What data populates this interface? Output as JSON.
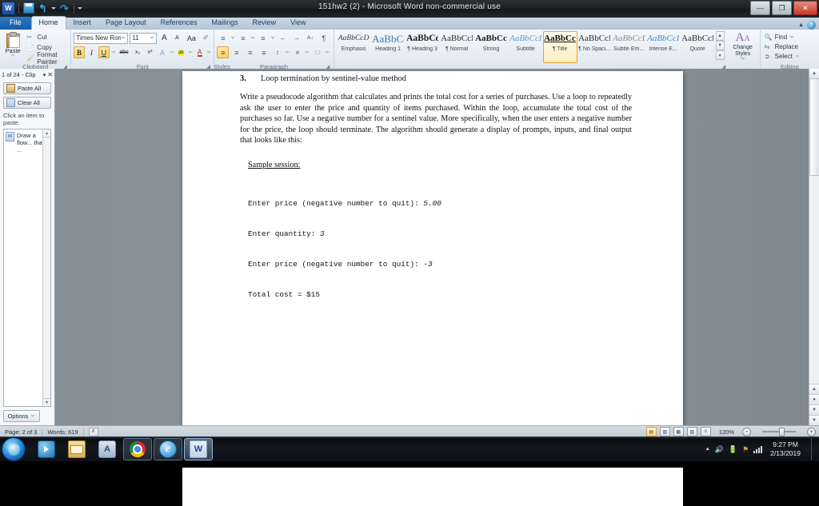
{
  "window": {
    "title": "151hw2 (2)  -  Microsoft Word non-commercial use",
    "app_icon": "W",
    "quick_access": [
      {
        "name": "save",
        "icon": "save-icon"
      },
      {
        "name": "undo",
        "icon": "undo-icon",
        "glyph": "↶"
      },
      {
        "name": "redo",
        "icon": "redo-icon",
        "glyph": "↷"
      }
    ],
    "controls": {
      "minimize": "—",
      "restore": "❐",
      "close": "✕"
    },
    "help": "?",
    "collapse_ribbon": "▲"
  },
  "ribbon": {
    "tabs": [
      {
        "label": "File",
        "type": "file"
      },
      {
        "label": "Home",
        "active": true
      },
      {
        "label": "Insert"
      },
      {
        "label": "Page Layout"
      },
      {
        "label": "References"
      },
      {
        "label": "Mailings"
      },
      {
        "label": "Review"
      },
      {
        "label": "View"
      }
    ],
    "clipboard": {
      "group_label": "Clipboard",
      "paste_label": "Paste",
      "cut_label": "Cut",
      "copy_label": "Copy",
      "format_painter_label": "Format Painter"
    },
    "font": {
      "group_label": "Font",
      "font_name": "Times New Rom",
      "font_size": "11",
      "grow_font": "A",
      "shrink_font": "A",
      "change_case": "Aa",
      "clear_formatting": "✐",
      "bold": "B",
      "italic": "I",
      "underline": "U",
      "strikethrough": "abc",
      "subscript": "x₂",
      "superscript": "x²",
      "text_effects": "A",
      "highlight": "ab",
      "font_color": "A"
    },
    "paragraph": {
      "group_label": "Paragraph",
      "bullets": "≡",
      "numbering": "≡",
      "multilevel": "≡",
      "decrease_indent": "←",
      "increase_indent": "→",
      "sort": "A↓",
      "show_marks": "¶",
      "align_left": "≡",
      "align_center": "≡",
      "align_right": "≡",
      "justify": "≡",
      "line_spacing": "↕",
      "shading": "■",
      "borders": "□"
    },
    "styles": {
      "group_label": "Styles",
      "items": [
        {
          "preview": "AaBbCcD",
          "name": "Emphasis",
          "style": "emphasis"
        },
        {
          "preview": "AaBbCс",
          "name": "Heading 1",
          "style": "heading1"
        },
        {
          "preview": "AaBbCc",
          "name": "¶ Heading 3",
          "style": "heading3"
        },
        {
          "preview": "AaBbCcI",
          "name": "¶ Normal",
          "style": "normal"
        },
        {
          "preview": "AaBbCcI",
          "name": "Strong",
          "style": "strong"
        },
        {
          "preview": "AaBbCcI",
          "name": "Subtitle",
          "style": "subtitle"
        },
        {
          "preview": "AaBbCcI",
          "name": "¶ Title",
          "style": "title",
          "selected": true
        },
        {
          "preview": "AaBbCcI",
          "name": "¶ No Spaci...",
          "style": "nospacing"
        },
        {
          "preview": "AaBbCcD",
          "name": "Subtle Em...",
          "style": "subtleem"
        },
        {
          "preview": "AaBbCcI",
          "name": "Intense E...",
          "style": "intenseem"
        },
        {
          "preview": "AaBbCcD",
          "name": "Quote",
          "style": "quote"
        }
      ],
      "change_styles_label": "Change Styles"
    },
    "editing": {
      "group_label": "Editing",
      "find_label": "Find",
      "replace_label": "Replace",
      "select_label": "Select"
    }
  },
  "clipboard_pane": {
    "title": "1 of 24 - Clip",
    "close": "✕",
    "menu_caret": "▾",
    "paste_all_label": "Paste All",
    "clear_all_label": "Clear All",
    "hint": "Click an item to paste:",
    "items": [
      {
        "icon": "word-doc-icon",
        "text": "Draw a flow... that ..."
      }
    ],
    "options_label": "Options"
  },
  "document": {
    "question_number": "3.",
    "question_title": "Loop termination by sentinel-value method",
    "paragraph": "Write a pseudocode algorithm that calculates and prints the total cost for a series of purchases. Use a loop to repeatedly ask the user to enter the price and quantity of items purchased. Within the loop, accumulate the total cost of the purchases so far. Use a negative number for a sentinel value. More specifically, when the user enters a negative number for the price, the loop should terminate. The algorithm should generate a display of prompts, inputs, and final output that looks like this:",
    "sample_label": "Sample session:",
    "sample_lines": [
      {
        "prompt": "Enter price (negative number to quit): ",
        "input": "5.00"
      },
      {
        "prompt": "Enter quantity: ",
        "input": "3"
      },
      {
        "prompt": "Enter price (negative number to quit): ",
        "input": "-3"
      },
      {
        "prompt": "Total cost = $15",
        "input": ""
      }
    ]
  },
  "status_bar": {
    "page": "Page: 2 of 3",
    "words": "Words: 619",
    "proofing_icon": "proofing-errors-icon",
    "views": [
      {
        "name": "print-layout",
        "glyph": "▤",
        "active": true
      },
      {
        "name": "full-screen-reading",
        "glyph": "▥",
        "active": false
      },
      {
        "name": "web-layout",
        "glyph": "▦",
        "active": false
      },
      {
        "name": "outline",
        "glyph": "▧",
        "active": false
      },
      {
        "name": "draft",
        "glyph": "≡",
        "active": false
      }
    ],
    "zoom": "120%",
    "zoom_out": "−",
    "zoom_in": "+"
  },
  "taskbar": {
    "start": "start-orb",
    "items": [
      {
        "name": "windows-media-player",
        "icon": "media-player-icon"
      },
      {
        "name": "windows-explorer",
        "icon": "folder-icon"
      },
      {
        "name": "app-a",
        "icon": "a-icon",
        "label": "A"
      },
      {
        "name": "google-chrome",
        "icon": "chrome-icon"
      },
      {
        "name": "internet-explorer",
        "icon": "ie-icon",
        "label": "e"
      },
      {
        "name": "microsoft-word",
        "icon": "word-icon",
        "label": "W",
        "active": true
      }
    ],
    "tray": {
      "show_hidden": "▲",
      "volume": "volume-icon",
      "battery": "battery-icon",
      "security": "action-center-icon",
      "network": "network-icon",
      "time": "9:27 PM",
      "date": "2/13/2019"
    }
  }
}
